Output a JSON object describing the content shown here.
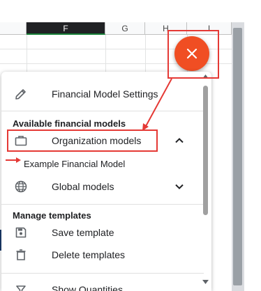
{
  "sheet": {
    "columns": [
      {
        "label": "F",
        "active": true
      },
      {
        "label": "G",
        "active": false
      },
      {
        "label": "H",
        "active": false
      },
      {
        "label": "I",
        "active": false
      }
    ]
  },
  "fab": {
    "icon": "close-icon",
    "color": "#f04e23"
  },
  "menu": {
    "settings_label": "Financial Model Settings",
    "available_title": "Available financial models",
    "org_models_label": "Organization models",
    "example_model_label": "Example Financial Model",
    "global_models_label": "Global models",
    "manage_title": "Manage templates",
    "save_template_label": "Save template",
    "delete_templates_label": "Delete templates",
    "show_quantities_label": "Show Quantities"
  },
  "annotation_color": "#e53935"
}
